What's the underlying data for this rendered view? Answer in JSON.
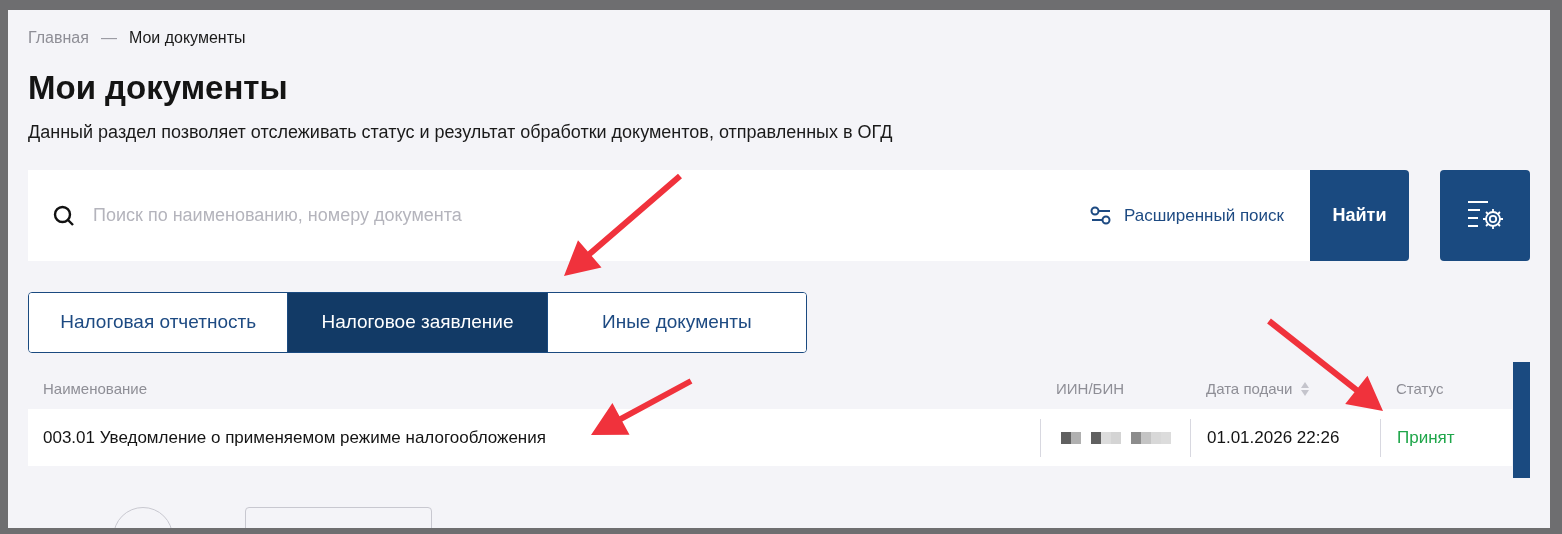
{
  "breadcrumbs": [
    {
      "label": "Главная",
      "current": false
    },
    {
      "label": "Мои документы",
      "current": true
    }
  ],
  "breadcrumb_separator": "—",
  "title": "Мои документы",
  "description": "Данный раздел позволяет отслеживать статус и результат обработки документов, отправленных в ОГД",
  "search": {
    "placeholder": "Поиск по наименованию, номеру документа",
    "advanced_label": "Расширенный поиск",
    "submit_label": "Найти"
  },
  "tabs": [
    {
      "label": "Налоговая отчетность",
      "selected": false
    },
    {
      "label": "Налоговое заявление",
      "selected": true
    },
    {
      "label": "Иные документы",
      "selected": false
    }
  ],
  "table": {
    "columns": [
      {
        "label": "Наименование",
        "sortable": false
      },
      {
        "label": "ИИН/БИН",
        "sortable": false
      },
      {
        "label": "Дата подачи",
        "sortable": true
      },
      {
        "label": "Статус",
        "sortable": false
      }
    ],
    "rows": [
      {
        "name": "003.01 Уведомление о применяемом режиме налогообложения",
        "iin_redacted": true,
        "date": "01.01.2026 22:26",
        "status": "Принят",
        "color": "#1fa64a"
      }
    ]
  }
}
